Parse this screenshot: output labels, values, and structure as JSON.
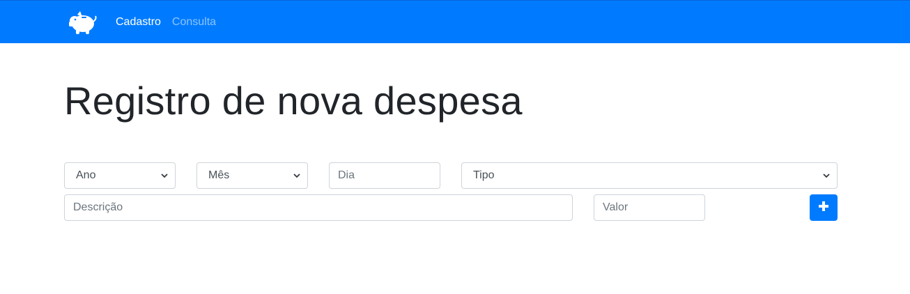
{
  "navbar": {
    "brand_icon": "piggy-bank-icon",
    "links": [
      {
        "label": "Cadastro",
        "active": true
      },
      {
        "label": "Consulta",
        "active": false
      }
    ],
    "background": "#007bff"
  },
  "main": {
    "title": "Registro de nova despesa",
    "form": {
      "ano": {
        "selected": "Ano"
      },
      "mes": {
        "selected": "Mês"
      },
      "dia": {
        "placeholder": "Dia",
        "value": ""
      },
      "tipo": {
        "selected": "Tipo"
      },
      "descricao": {
        "placeholder": "Descrição",
        "value": ""
      },
      "valor": {
        "placeholder": "Valor",
        "value": ""
      },
      "add_button": {
        "icon": "plus-icon",
        "color": "#007bff"
      }
    }
  }
}
